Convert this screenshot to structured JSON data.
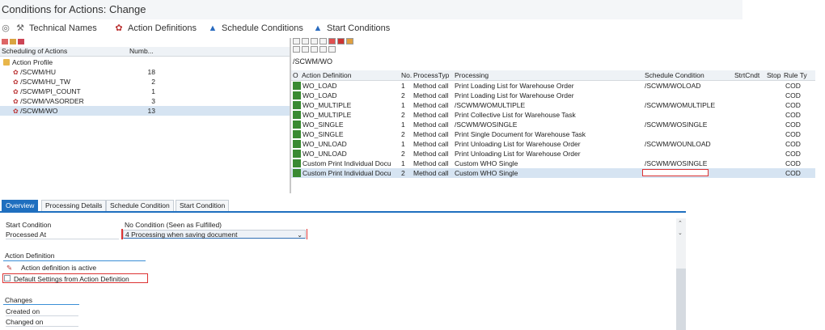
{
  "window": {
    "title": "Conditions for Actions: Change"
  },
  "toolbar": {
    "technical_names": "Technical Names",
    "action_definitions": "Action Definitions",
    "schedule_conditions": "Schedule Conditions",
    "start_conditions": "Start Conditions"
  },
  "tree": {
    "col_name": "Scheduling of Actions",
    "col_num": "Numb...",
    "root": "Action Profile",
    "items": [
      {
        "label": "/SCWM/HU",
        "num": "18"
      },
      {
        "label": "/SCWM/HU_TW",
        "num": "2"
      },
      {
        "label": "/SCWM/PI_COUNT",
        "num": "1"
      },
      {
        "label": "/SCWM/VASORDER",
        "num": "3"
      },
      {
        "label": "/SCWM/WO",
        "num": "13"
      }
    ]
  },
  "table": {
    "path": "/SCWM/WO",
    "headers": {
      "o": "O",
      "def": "Action Definition",
      "no": "No.",
      "pt": "ProcessTyp",
      "pr": "Processing",
      "sc": "Schedule Condition",
      "start": "StrtCndt",
      "stop": "Stop",
      "rt": "Rule Ty"
    },
    "rows": [
      {
        "def": "WO_LOAD",
        "no": "1",
        "pt": "Method call",
        "pr": "Print Loading List for Warehouse Order",
        "sc": "/SCWM/WOLOAD",
        "rt": "COD"
      },
      {
        "def": "WO_LOAD",
        "no": "2",
        "pt": "Method call",
        "pr": "Print Loading List for Warehouse Order",
        "sc": "",
        "rt": "COD"
      },
      {
        "def": "WO_MULTIPLE",
        "no": "1",
        "pt": "Method call",
        "pr": "/SCWM/WOMULTIPLE",
        "sc": "/SCWM/WOMULTIPLE",
        "rt": "COD"
      },
      {
        "def": "WO_MULTIPLE",
        "no": "2",
        "pt": "Method call",
        "pr": "Print Collective List for Warehouse Task",
        "sc": "",
        "rt": "COD"
      },
      {
        "def": "WO_SINGLE",
        "no": "1",
        "pt": "Method call",
        "pr": "/SCWM/WOSINGLE",
        "sc": "/SCWM/WOSINGLE",
        "rt": "COD"
      },
      {
        "def": "WO_SINGLE",
        "no": "2",
        "pt": "Method call",
        "pr": "Print Single Document for Warehouse Task",
        "sc": "",
        "rt": "COD"
      },
      {
        "def": "WO_UNLOAD",
        "no": "1",
        "pt": "Method call",
        "pr": "Print Unloading List for Warehouse Order",
        "sc": "/SCWM/WOUNLOAD",
        "rt": "COD"
      },
      {
        "def": "WO_UNLOAD",
        "no": "2",
        "pt": "Method call",
        "pr": "Print Unloading List for Warehouse Order",
        "sc": "",
        "rt": "COD"
      },
      {
        "def": "Custom Print Individual Docu",
        "no": "1",
        "pt": "Method call",
        "pr": "Custom WHO Single",
        "sc": "/SCWM/WOSINGLE",
        "rt": "COD"
      },
      {
        "def": "Custom Print Individual Docu",
        "no": "2",
        "pt": "Method call",
        "pr": "Custom WHO Single",
        "sc": "",
        "rt": "COD"
      }
    ]
  },
  "tabs": [
    "Overview",
    "Processing Details",
    "Schedule Condition",
    "Start Condition"
  ],
  "overview": {
    "start_condition_label": "Start Condition",
    "start_condition_value": "No Condition (Seen as Fulfilled)",
    "processed_at_label": "Processed At",
    "processed_at_value": "4 Processing when saving document",
    "action_definition_title": "Action Definition",
    "active_text": "Action definition is active",
    "default_settings": "Default Settings from Action Definition",
    "changes_title": "Changes",
    "created_on": "Created on",
    "changed_on": "Changed on"
  },
  "colors": {
    "accent": "#1f6fbf",
    "active_green": "#3a8a32",
    "highlight_red": "#d33333",
    "selection": "#d6e4f2"
  }
}
